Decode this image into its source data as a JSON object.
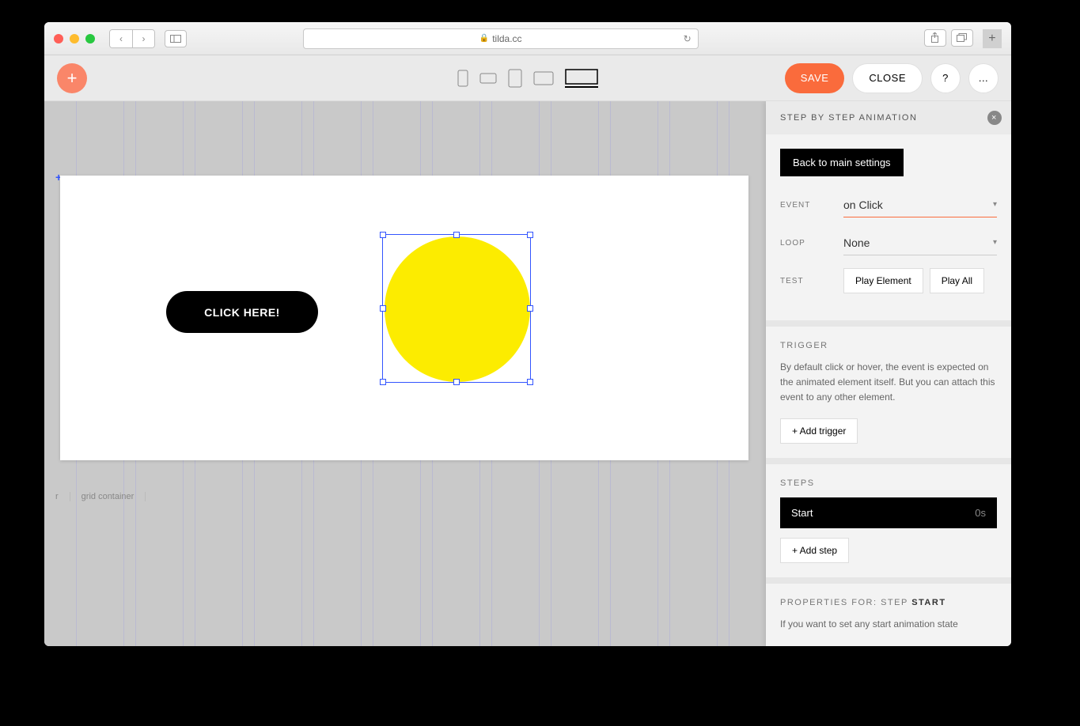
{
  "browser": {
    "url": "tilda.cc"
  },
  "toolbar": {
    "save": "SAVE",
    "close": "CLOSE",
    "help": "?",
    "more": "..."
  },
  "canvas": {
    "button_label": "CLICK HERE!",
    "breadcrumb": [
      "r",
      "grid container"
    ]
  },
  "panel": {
    "title": "STEP BY STEP ANIMATION",
    "back_button": "Back to main settings",
    "event": {
      "label": "EVENT",
      "value": "on Click"
    },
    "loop": {
      "label": "LOOP",
      "value": "None"
    },
    "test": {
      "label": "TEST",
      "play_element": "Play Element",
      "play_all": "Play All"
    },
    "trigger": {
      "title": "TRIGGER",
      "description": "By default click or hover, the event is expected on the animated element itself. But you can attach this event to any other element.",
      "add_button": "+ Add trigger"
    },
    "steps": {
      "title": "STEPS",
      "start_label": "Start",
      "start_time": "0s",
      "add_button": "+ Add step"
    },
    "properties": {
      "prefix": "PROPERTIES FOR: STEP ",
      "step_name": "START",
      "description": "If you want to set any start animation state"
    }
  }
}
